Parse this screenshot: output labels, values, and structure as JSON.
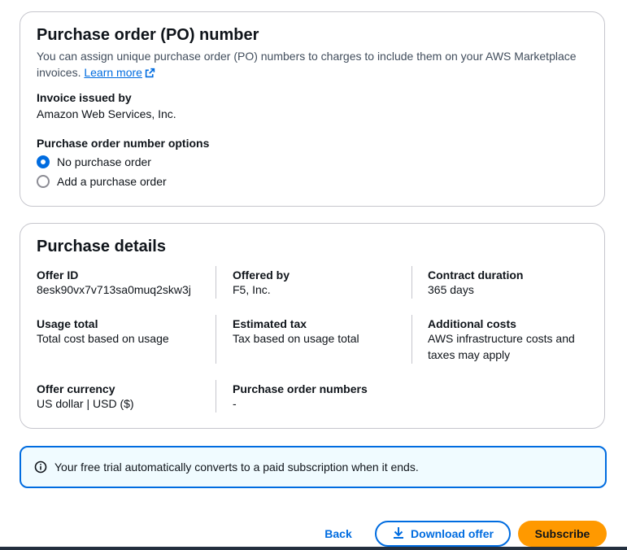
{
  "po_section": {
    "title": "Purchase order (PO) number",
    "description": "You can assign unique purchase order (PO) numbers to charges to include them on your AWS Marketplace invoices.",
    "learn_more": "Learn more",
    "invoice_label": "Invoice issued by",
    "invoice_value": "Amazon Web Services, Inc.",
    "options_label": "Purchase order number options",
    "options": [
      {
        "label": "No purchase order",
        "checked": true
      },
      {
        "label": "Add a purchase order",
        "checked": false
      }
    ]
  },
  "details": {
    "title": "Purchase details",
    "fields": [
      {
        "label": "Offer ID",
        "value": "8esk90vx7v713sa0muq2skw3j"
      },
      {
        "label": "Offered by",
        "value": "F5, Inc."
      },
      {
        "label": "Contract duration",
        "value": "365 days"
      },
      {
        "label": "Usage total",
        "value": "Total cost based on usage"
      },
      {
        "label": "Estimated tax",
        "value": "Tax based on usage total"
      },
      {
        "label": "Additional costs",
        "value": "AWS infrastructure costs and taxes may apply"
      },
      {
        "label": "Offer currency",
        "value": "US dollar | USD ($)"
      },
      {
        "label": "Purchase order numbers",
        "value": "-"
      }
    ]
  },
  "alert": {
    "text": "Your free trial automatically converts to a paid subscription when it ends."
  },
  "actions": {
    "back": "Back",
    "download": "Download offer",
    "subscribe": "Subscribe"
  },
  "colors": {
    "link": "#006ce0",
    "primary": "#ff9900",
    "alert_bg": "#f0fbff",
    "border": "#c6c6cd"
  }
}
